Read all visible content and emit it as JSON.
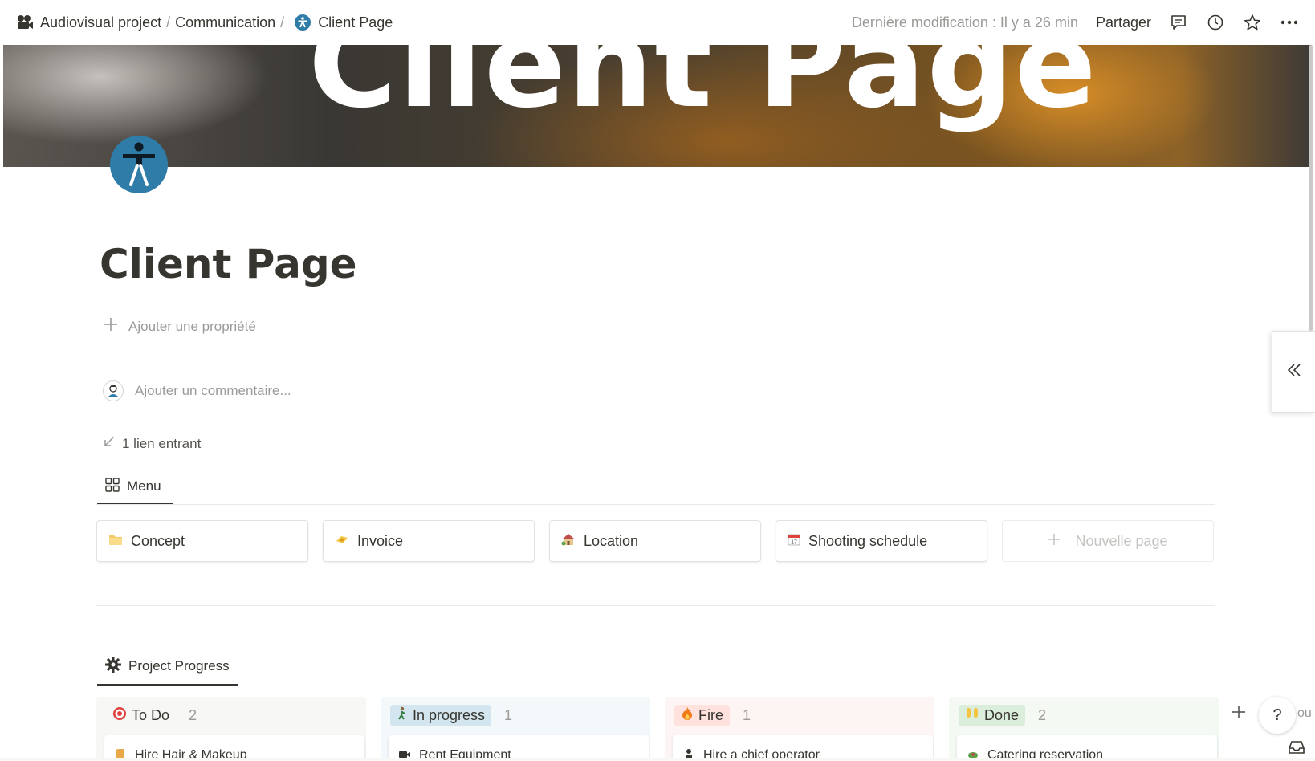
{
  "breadcrumb": {
    "items": [
      "Audiovisual project",
      "Communication",
      "Client Page"
    ],
    "separator": "/"
  },
  "topbar": {
    "edited": "Dernière modification : Il y a 26 min",
    "share": "Partager",
    "icons": [
      "comment-icon",
      "history-icon",
      "star-icon",
      "more-icon"
    ]
  },
  "cover": {
    "text": "Client Page"
  },
  "page": {
    "title": "Client Page",
    "add_property": "Ajouter une propriété",
    "comment_placeholder": "Ajouter un commentaire...",
    "backlinks": "1 lien entrant"
  },
  "menu_tab": {
    "label": "Menu"
  },
  "menu_cards": [
    {
      "label": "Concept",
      "icon": "folder-icon"
    },
    {
      "label": "Invoice",
      "icon": "money-icon"
    },
    {
      "label": "Location",
      "icon": "house-icon"
    },
    {
      "label": "Shooting schedule",
      "icon": "calendar-icon"
    }
  ],
  "new_page": "Nouvelle page",
  "progress_tab": {
    "label": "Project Progress"
  },
  "board": {
    "columns": [
      {
        "label": "To Do",
        "count": "2",
        "card": "Hire Hair & Makeup",
        "bg": "#f4f4f2",
        "pill": "#ebebea"
      },
      {
        "label": "In progress",
        "count": "1",
        "card": "Rent Equipment",
        "bg": "#eef6fb",
        "pill": "#d3e5ef"
      },
      {
        "label": "Fire",
        "count": "1",
        "card": "Hire a chief operator",
        "bg": "#fbeeee",
        "pill": "#ffe2dd"
      },
      {
        "label": "Done",
        "count": "2",
        "card": "Catering reservation",
        "bg": "#eef6ef",
        "pill": "#dbeddb"
      }
    ]
  },
  "help": "?",
  "peek_text": "ou"
}
